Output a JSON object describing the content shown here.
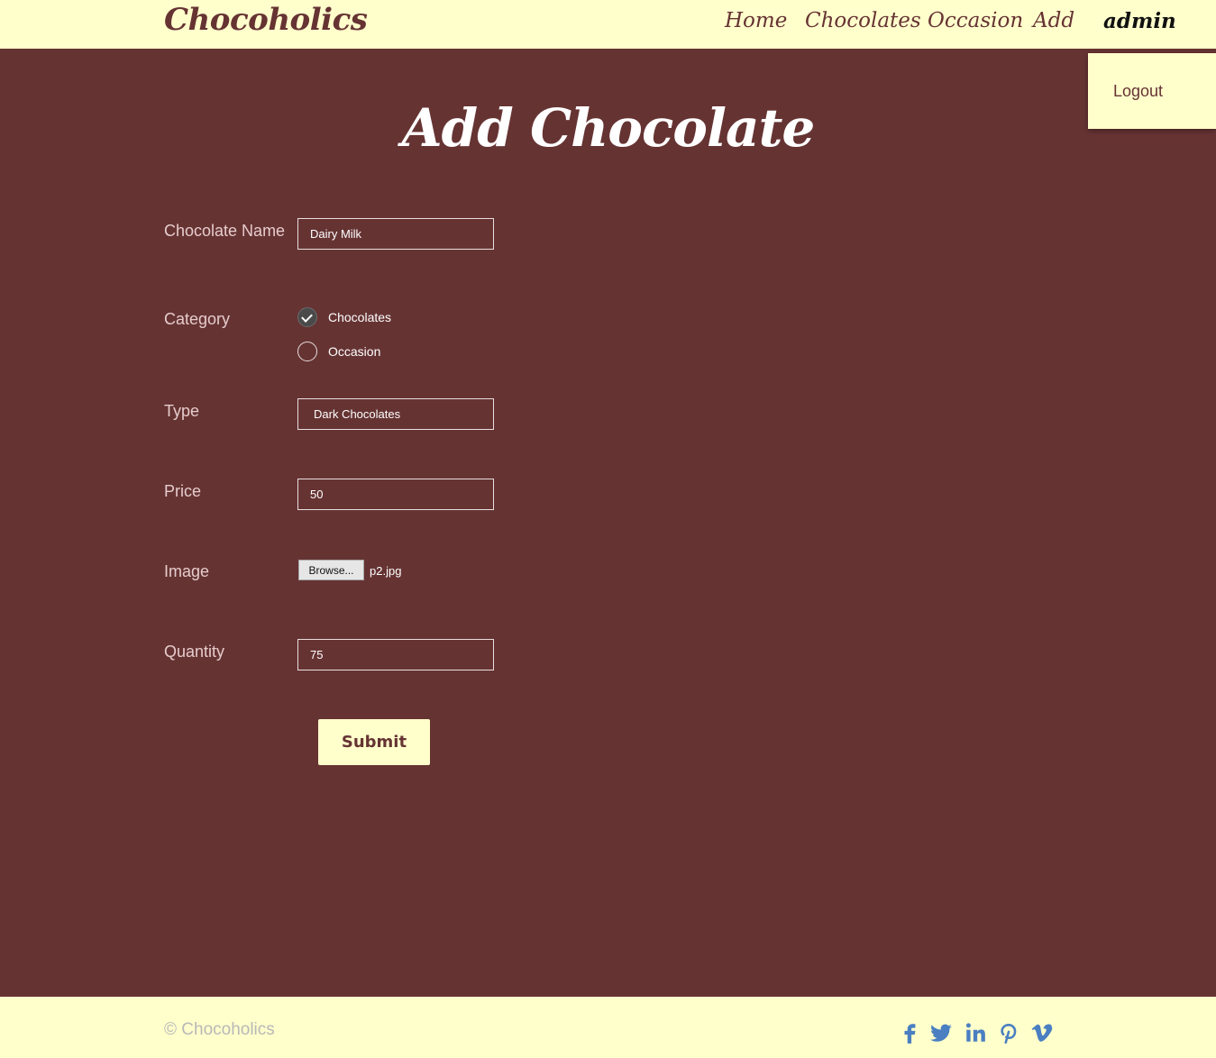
{
  "header": {
    "brand": "Chocoholics",
    "nav": {
      "home": "Home",
      "chocolates": "Chocolates",
      "occasion": "Occasion",
      "add": "Add",
      "admin": "admin"
    },
    "dropdown": {
      "logout": "Logout"
    }
  },
  "page": {
    "title": "Add Chocolate"
  },
  "form": {
    "name": {
      "label": "Chocolate Name",
      "value": "Dairy Milk"
    },
    "category": {
      "label": "Category",
      "options": [
        "Chocolates",
        "Occasion"
      ],
      "selected": "Chocolates"
    },
    "type": {
      "label": "Type",
      "value": "Dark Chocolates"
    },
    "price": {
      "label": "Price",
      "value": "50"
    },
    "image": {
      "label": "Image",
      "browse_label": "Browse...",
      "file_name": "p2.jpg"
    },
    "quantity": {
      "label": "Quantity",
      "value": "75"
    },
    "submit_label": "Submit"
  },
  "footer": {
    "copyright": "© Chocoholics",
    "social": [
      "facebook-icon",
      "twitter-icon",
      "linkedin-icon",
      "pinterest-icon",
      "vimeo-icon"
    ]
  },
  "colors": {
    "background": "#663333",
    "header": "#ffffcc",
    "social_icons": "#4a7fc1"
  }
}
